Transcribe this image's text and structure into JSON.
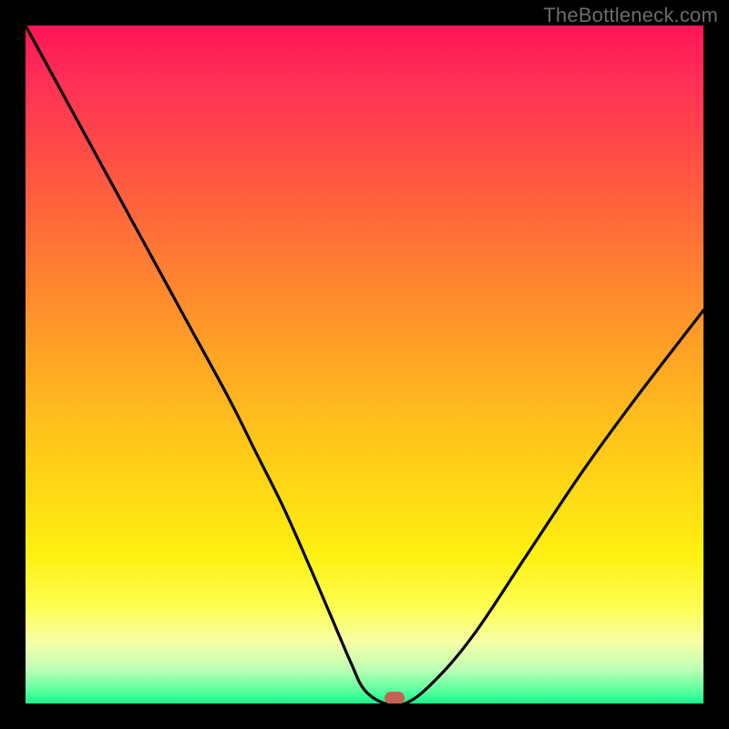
{
  "watermark": "TheBottleneck.com",
  "colors": {
    "frame_bg": "#000000",
    "curve_stroke": "#000000",
    "marker_fill": "#c96055"
  },
  "chart_data": {
    "type": "line",
    "title": "",
    "xlabel": "",
    "ylabel": "",
    "xlim": [
      0,
      100
    ],
    "ylim": [
      0,
      100
    ],
    "grid": false,
    "series": [
      {
        "name": "bottleneck-curve",
        "x": [
          0,
          6,
          12,
          18,
          24,
          30,
          34,
          38,
          42,
          45,
          48,
          50,
          53,
          56,
          60,
          66,
          74,
          82,
          90,
          100
        ],
        "y": [
          100,
          89,
          78,
          67,
          56,
          45,
          37,
          29,
          20,
          13,
          6,
          2,
          0,
          0,
          3,
          10,
          22,
          34,
          45,
          58
        ]
      }
    ],
    "marker": {
      "x": 54.5,
      "y": 0
    },
    "gradient_stops": [
      {
        "pos": 0,
        "hex": "#ff1557"
      },
      {
        "pos": 8,
        "hex": "#ff2f56"
      },
      {
        "pos": 20,
        "hex": "#ff5044"
      },
      {
        "pos": 33,
        "hex": "#ff7735"
      },
      {
        "pos": 48,
        "hex": "#ffa225"
      },
      {
        "pos": 63,
        "hex": "#ffcb18"
      },
      {
        "pos": 78,
        "hex": "#fef010"
      },
      {
        "pos": 86,
        "hex": "#feff55"
      },
      {
        "pos": 91,
        "hex": "#f6ffa6"
      },
      {
        "pos": 95,
        "hex": "#bdffb5"
      },
      {
        "pos": 98,
        "hex": "#5eff9f"
      },
      {
        "pos": 100,
        "hex": "#17f58d"
      }
    ]
  }
}
